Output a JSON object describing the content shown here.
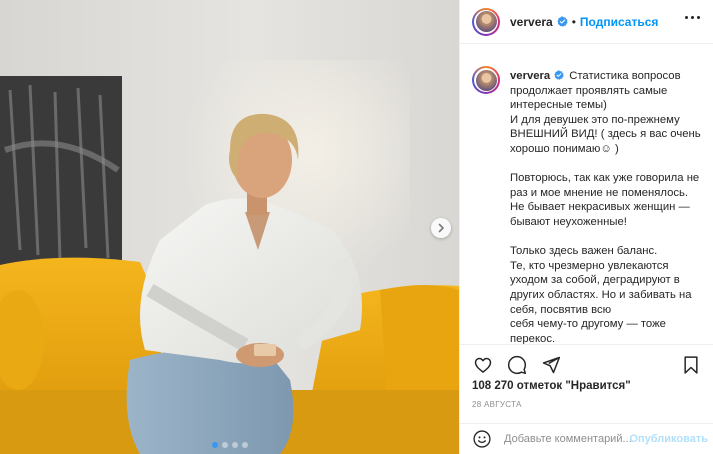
{
  "post": {
    "username": "ververa",
    "follow_label": "Подписаться",
    "separator": "•",
    "likes_text": "108 270 отметок \"Нравится\"",
    "date": "28 АВГУСТА",
    "caption": {
      "username": "ververa",
      "lines": [
        "Статистика вопросов продолжает проявлять самые интересные темы)",
        "И для девушек это по-прежнему ВНЕШНИЙ ВИД! ( здесь я вас очень хорошо понимаю☺ )",
        "",
        "Повторюсь, так как уже говорила не раз и мое мнение не поменялось. Не бывает некрасивых женщин — бывают неухоженные!",
        "",
        "Только здесь важен баланс.",
        "Те, кто чрезмерно увлекаются уходом за собой, деградируют в других областях. Но и забивать на себя, посвятив всю",
        "себя чему-то другому — тоже перекос."
      ]
    },
    "comment": {
      "placeholder": "Добавьте комментарий...",
      "publish_label": "Опубликовать"
    },
    "carousel": {
      "count": 4,
      "active": 0
    },
    "icons": {
      "verified": "verified-badge-icon",
      "more": "more-options-icon",
      "like": "heart-icon",
      "comment": "comment-icon",
      "share": "paper-plane-icon",
      "save": "bookmark-icon",
      "emoji": "smiley-icon",
      "next": "chevron-right-icon"
    },
    "colors": {
      "accent": "#0095f6",
      "verified": "#3897f0",
      "publish_disabled": "#b2dffc",
      "sofa": "#f0b21c"
    }
  }
}
